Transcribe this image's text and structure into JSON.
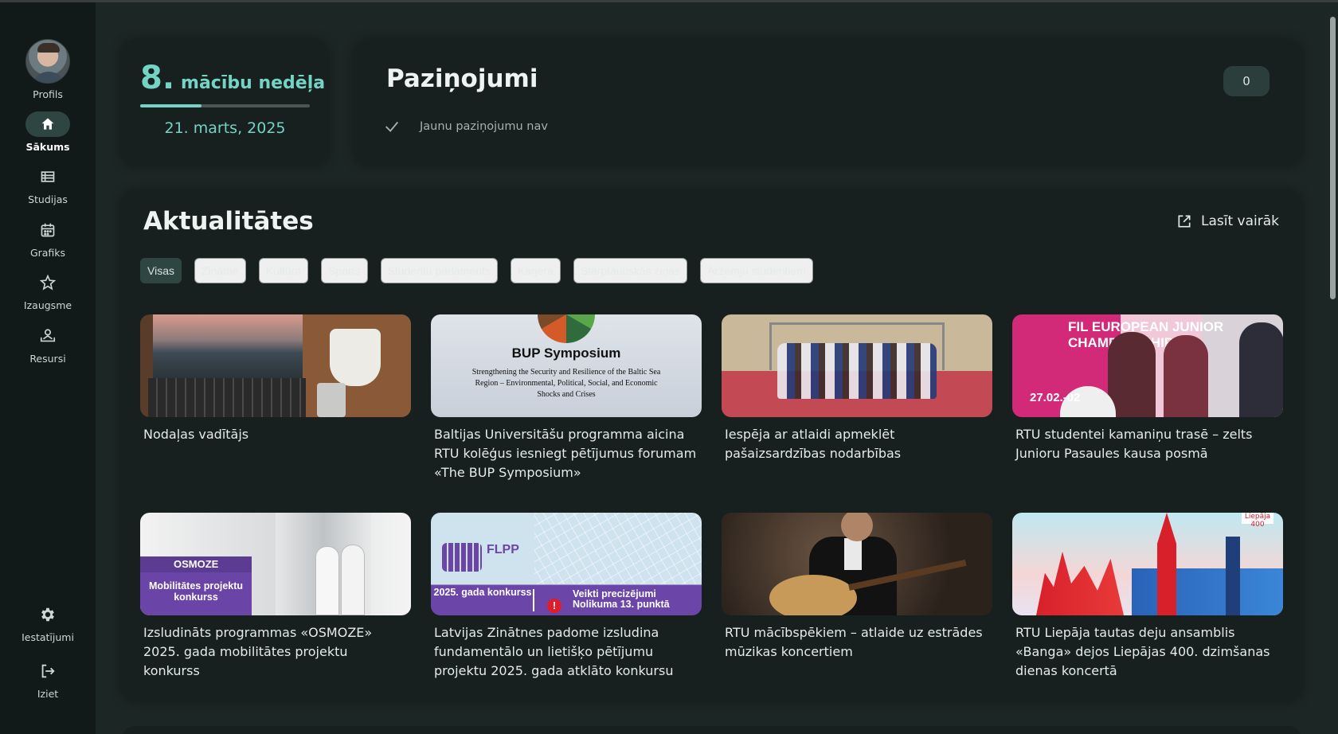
{
  "sidebar": {
    "profile_label": "Profils",
    "items": [
      {
        "label": "Sākums",
        "icon": "home-icon",
        "active": true
      },
      {
        "label": "Studijas",
        "icon": "list-icon",
        "active": false
      },
      {
        "label": "Grafiks",
        "icon": "calendar-icon",
        "active": false
      },
      {
        "label": "Izaugsme",
        "icon": "star-icon",
        "active": false
      },
      {
        "label": "Resursi",
        "icon": "resources-icon",
        "active": false
      }
    ],
    "bottom_items": [
      {
        "label": "Iestatījumi",
        "icon": "gear-icon"
      },
      {
        "label": "Iziet",
        "icon": "logout-icon"
      }
    ]
  },
  "week": {
    "number": "8.",
    "label": "mācību nedēļa",
    "date": "21. marts, 2025",
    "progress": 0.36
  },
  "notifications": {
    "title": "Paziņojumi",
    "count": "0",
    "empty_text": "Jaunu paziņojumu nav"
  },
  "news": {
    "title": "Aktualitātes",
    "read_more": "Lasīt vairāk",
    "filters": [
      "Visas",
      "Zinātne",
      "Kultūra",
      "Sports",
      "Studentu parlaments",
      "Karjera",
      "Starptautiskās ziņas",
      "Ārzemju studentiem"
    ],
    "active_filter": "Visas",
    "items": [
      {
        "title": "Nodaļas vadītājs"
      },
      {
        "title": "Baltijas Universitāšu programma aicina RTU kolēģus iesniegt pētījumus forumam «The BUP Symposium»",
        "image_text": {
          "heading": "BUP Symposium",
          "sub": "Strengthening the Security and Resilience of the Baltic Sea Region – Environmental, Political, Social, and Economic Shocks and Crises"
        }
      },
      {
        "title": "Iespēja ar atlaidi apmeklēt pašaizsardzības nodarbības"
      },
      {
        "title": "RTU studentei kamaniņu trasē – zelts Junioru Pasaules kausa posmā",
        "image_text": {
          "banner": "FIL EUROPEAN JUNIOR CHAMPIONSHIPS",
          "date": "27.02.-02"
        }
      },
      {
        "title": "Izsludināts programmas «OSMOZE» 2025. gada mobilitātes projektu konkurss",
        "image_text": {
          "tag": "OSMOZE",
          "label": "Mobilitātes projektu konkurss"
        }
      },
      {
        "title": "Latvijas Zinātnes padome izsludina fundamentālo un lietišķo pētījumu projektu 2025. gada atklāto konkursu",
        "image_text": {
          "logo": "FLPP",
          "left": "2025. gada konkurss",
          "right": "Veikti precizējumi Nolikuma 13. punktā"
        }
      },
      {
        "title": "RTU mācībspēkiem – atlaide uz estrādes mūzikas koncertiem"
      },
      {
        "title": "RTU Liepāja tautas deju ansamblis «Banga» dejos Liepājas 400. dzimšanas dienas koncertā",
        "image_text": {
          "badge": "Liepāja 400"
        }
      }
    ]
  },
  "colors": {
    "accent": "#73d3c4",
    "background": "#1c2624",
    "sidebar": "#111a19",
    "card": "#17201f",
    "active_pill": "#2f4542"
  }
}
